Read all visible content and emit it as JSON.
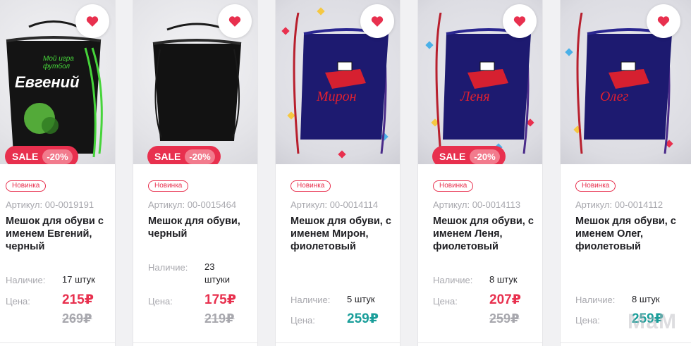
{
  "colors": {
    "accent": "#e8304e",
    "teal": "#1a9e9a",
    "muted": "#a8a8ae"
  },
  "labels": {
    "availability": "Наличие:",
    "price": "Цена:"
  },
  "products": [
    {
      "new_badge": "Новинка",
      "sku": "Артикул: 00-0019191",
      "title": "Мешок для обуви с именем Евгений, черный",
      "availability": "17 штук",
      "price": "215₽",
      "old_price": "269₽",
      "sale": "SALE",
      "discount": "-20%",
      "bag_color": "black",
      "name_on_bag": "Евгений",
      "top_text": "Мой игра футбол"
    },
    {
      "new_badge": "Новинка",
      "sku": "Артикул: 00-0015464",
      "title": "Мешок для обуви, черный",
      "availability": "23 штуки",
      "price": "175₽",
      "old_price": "219₽",
      "sale": "SALE",
      "discount": "-20%",
      "bag_color": "black"
    },
    {
      "new_badge": "Новинка",
      "sku": "Артикул: 00-0014114",
      "title": "Мешок для обуви, с именем Мирон, фиолетовый",
      "availability": "5 штук",
      "price": "259₽",
      "bag_color": "purple",
      "name_on_bag": "Мирон"
    },
    {
      "new_badge": "Новинка",
      "sku": "Артикул: 00-0014113",
      "title": "Мешок для обуви, с именем Леня, фиолетовый",
      "availability": "8 штук",
      "price": "207₽",
      "old_price": "259₽",
      "sale": "SALE",
      "discount": "-20%",
      "bag_color": "purple",
      "name_on_bag": "Леня"
    },
    {
      "new_badge": "Новинка",
      "sku": "Артикул: 00-0014112",
      "title": "Мешок для обуви, с именем Олег, фиолетовый",
      "availability": "8 штук",
      "price": "259₽",
      "bag_color": "purple",
      "name_on_bag": "Олег"
    }
  ],
  "watermark": "МаМ",
  "icons": {
    "favorite": "heart-icon"
  }
}
